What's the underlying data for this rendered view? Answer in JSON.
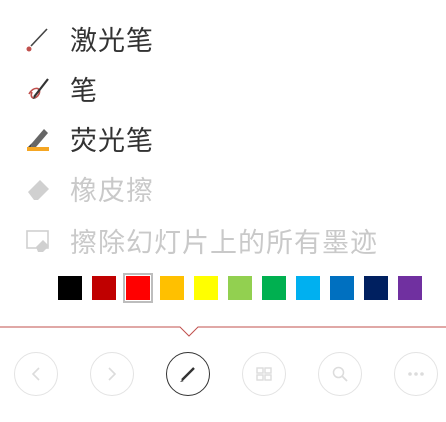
{
  "menu": {
    "items": [
      {
        "label": "激光笔",
        "icon": "laser-pointer-icon",
        "enabled": true
      },
      {
        "label": "笔",
        "icon": "pen-icon",
        "enabled": true
      },
      {
        "label": "荧光笔",
        "icon": "highlighter-icon",
        "enabled": true
      },
      {
        "label": "橡皮擦",
        "icon": "eraser-icon",
        "enabled": false
      },
      {
        "label": "擦除幻灯片上的所有墨迹",
        "icon": "erase-all-ink-icon",
        "enabled": false
      }
    ]
  },
  "palette": {
    "colors": [
      "#ffffff",
      "#000000",
      "#c00000",
      "#ff0000",
      "#ffc000",
      "#ffff00",
      "#92d050",
      "#00b050",
      "#00b0f0",
      "#0070c0",
      "#002060",
      "#7030a0"
    ],
    "selected_index": 3
  },
  "toolbar": {
    "buttons": [
      {
        "icon": "previous-icon",
        "active": false
      },
      {
        "icon": "next-icon",
        "active": false
      },
      {
        "icon": "pen-tool-icon",
        "active": true
      },
      {
        "icon": "slides-icon",
        "active": false
      },
      {
        "icon": "zoom-icon",
        "active": false
      },
      {
        "icon": "more-icon",
        "active": false
      }
    ]
  },
  "colors": {
    "accent": "#c0504d",
    "disabled": "#c9c9c9",
    "text": "#333333"
  }
}
